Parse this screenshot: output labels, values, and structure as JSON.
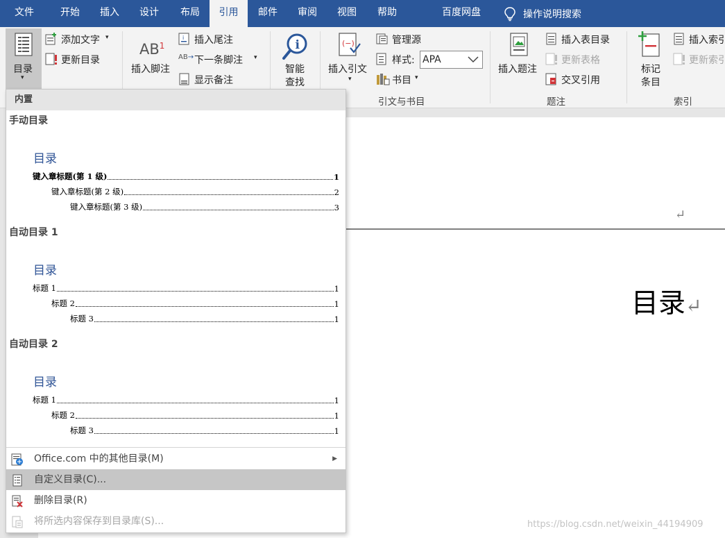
{
  "menubar": {
    "tabs": [
      "文件",
      "开始",
      "插入",
      "设计",
      "布局",
      "引用",
      "邮件",
      "审阅",
      "视图",
      "帮助",
      "百度网盘"
    ],
    "active_tab": "引用",
    "tell_me": "操作说明搜索"
  },
  "ribbon": {
    "toc": {
      "button": "目录",
      "add_text": "添加文字",
      "update_toc": "更新目录"
    },
    "footnotes": {
      "insert_footnote": "插入脚注",
      "insert_endnote": "插入尾注",
      "next_footnote": "下一条脚注",
      "show_notes": "显示备注",
      "ab_glyph": "AB",
      "ab_superscript": "1"
    },
    "research": {
      "smart_lookup_line1": "智能",
      "smart_lookup_line2": "查找"
    },
    "citations": {
      "insert_citation": "插入引文",
      "manage_sources": "管理源",
      "style_label": "样式:",
      "style_value": "APA",
      "bibliography": "书目",
      "group_label": "引文与书目"
    },
    "captions": {
      "insert_caption": "插入题注",
      "insert_table_of_figures": "插入表目录",
      "update_table": "更新表格",
      "cross_reference": "交叉引用",
      "group_label": "题注"
    },
    "index": {
      "mark_entry_line1": "标记",
      "mark_entry_line2": "条目",
      "insert_index": "插入索引",
      "update_index": "更新索引",
      "group_label": "索引"
    }
  },
  "dropdown": {
    "section_header": "内置",
    "galleries": [
      {
        "title": "手动目录",
        "preview_title": "目录",
        "lines": [
          {
            "text": "键入章标题(第 1 级)",
            "page": "1",
            "bold": true
          },
          {
            "text": "键入章标题(第 2 级)",
            "page": "2",
            "bold": false
          },
          {
            "text": "键入章标题(第 3 级)",
            "page": "3",
            "bold": false
          }
        ]
      },
      {
        "title": "自动目录 1",
        "preview_title": "目录",
        "lines": [
          {
            "text": "标题 1",
            "page": "1",
            "bold": false
          },
          {
            "text": "标题 2",
            "page": "1",
            "bold": false
          },
          {
            "text": "标题 3",
            "page": "1",
            "bold": false
          }
        ]
      },
      {
        "title": "自动目录 2",
        "preview_title": "目录",
        "lines": [
          {
            "text": "标题 1",
            "page": "1",
            "bold": false
          },
          {
            "text": "标题 2",
            "page": "1",
            "bold": false
          },
          {
            "text": "标题 3",
            "page": "1",
            "bold": false
          }
        ]
      }
    ],
    "commands": [
      {
        "label": "Office.com 中的其他目录(M)",
        "has_submenu": true,
        "disabled": false,
        "selected": false
      },
      {
        "label": "自定义目录(C)...",
        "has_submenu": false,
        "disabled": false,
        "selected": true
      },
      {
        "label": "删除目录(R)",
        "has_submenu": false,
        "disabled": false,
        "selected": false
      },
      {
        "label": "将所选内容保存到目录库(S)...",
        "has_submenu": false,
        "disabled": true,
        "selected": false
      }
    ]
  },
  "document": {
    "heading": "目录",
    "paragraph_mark": "↵"
  },
  "watermark": "https://blog.csdn.net/weixin_44194909",
  "colors": {
    "accent": "#2b579a",
    "heading_blue": "#2f5496",
    "selected_item": "#c6c6c6"
  }
}
